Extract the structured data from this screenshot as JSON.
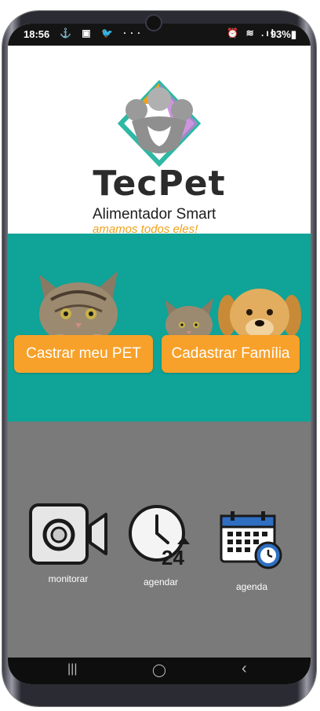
{
  "status": {
    "time": "18:56",
    "left_icons": "⚓ ▣ 🐦 ···",
    "right_icons": "⏰ ≋ .ıl",
    "battery": "93%▮"
  },
  "brand": {
    "name": "TecPet",
    "subtitle": "Alimentador Smart",
    "tagline": "amamos todos eles!"
  },
  "pets": {
    "castrar_label": "Castrar meu PET",
    "cadastrar_label": "Cadastrar Família"
  },
  "actions": [
    {
      "label": "monitorar",
      "icon": "video-camera-icon"
    },
    {
      "label": "agendar",
      "icon": "clock-24-icon"
    },
    {
      "label": "agenda",
      "icon": "calendar-clock-icon"
    }
  ],
  "navbar": {
    "recents": "|||",
    "home": "◯",
    "back": "‹"
  },
  "colors": {
    "teal": "#10a397",
    "orange": "#f7a12a",
    "gray": "#7a7a7a",
    "tagline": "#f2a01a"
  }
}
